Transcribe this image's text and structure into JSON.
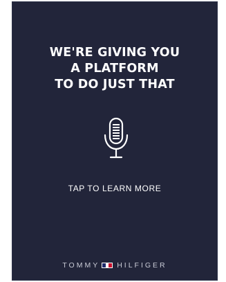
{
  "ad": {
    "headline_lines": [
      "WE'RE GIVING YOU",
      "A PLATFORM",
      "TO DO JUST THAT"
    ],
    "cta_label": "TAP TO LEARN MORE",
    "brand": {
      "left_word": "TOMMY",
      "right_word": "HILFIGER"
    },
    "icons": {
      "microphone": "microphone-icon",
      "flag_logo": "tommy-hilfiger-flag-icon"
    },
    "colors": {
      "background": "#22253a",
      "text": "#ffffff",
      "brand_navy": "#1e2a6b",
      "brand_red": "#c8102e"
    }
  }
}
